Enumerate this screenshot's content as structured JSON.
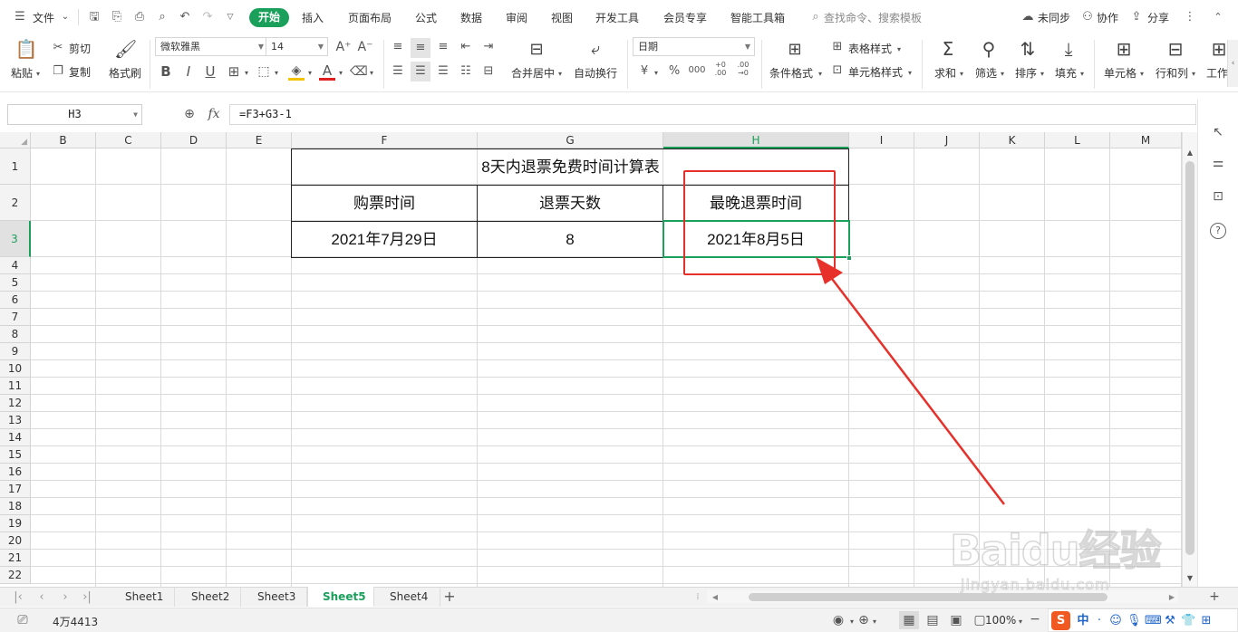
{
  "menubar": {
    "file_menu": "文件",
    "tabs": [
      "开始",
      "插入",
      "页面布局",
      "公式",
      "数据",
      "审阅",
      "视图",
      "开发工具",
      "会员专享",
      "智能工具箱"
    ],
    "search_placeholder": "查找命令、搜索模板",
    "sync": "未同步",
    "collab": "协作",
    "share": "分享"
  },
  "ribbon": {
    "paste": "粘贴",
    "cut": "剪切",
    "copy": "复制",
    "format_painter": "格式刷",
    "font_name": "微软雅黑",
    "font_size": "14",
    "merge_center": "合并居中",
    "wrap_text": "自动换行",
    "number_format": "日期",
    "conditional_format": "条件格式",
    "table_style": "表格样式",
    "cell_style": "单元格样式",
    "sum": "求和",
    "filter": "筛选",
    "sort": "排序",
    "fill": "填充",
    "cell": "单元格",
    "row_col": "行和列",
    "worksheet": "工作",
    "currency_symbol": "¥",
    "percent_symbol": "%",
    "thousands_symbol": "000",
    "dec_inc": "+0 .00",
    "dec_dec": ".00 →0"
  },
  "formula_bar": {
    "name_box": "H3",
    "fx_label": "fx",
    "formula": "=F3+G3-1"
  },
  "columns": [
    "B",
    "C",
    "D",
    "E",
    "F",
    "G",
    "H",
    "I",
    "J",
    "K",
    "L",
    "M"
  ],
  "rows": [
    "1",
    "2",
    "3",
    "4",
    "5",
    "6",
    "7",
    "8",
    "9",
    "10",
    "11",
    "12",
    "13",
    "14",
    "15",
    "16",
    "17",
    "18",
    "19",
    "20",
    "21",
    "22"
  ],
  "table": {
    "title": "8天内退票免费时间计算表",
    "headers": [
      "购票时间",
      "退票天数",
      "最晚退票时间"
    ],
    "values": [
      "2021年7月29日",
      "8",
      "2021年8月5日"
    ]
  },
  "sheets": [
    "Sheet1",
    "Sheet2",
    "Sheet3",
    "Sheet5",
    "Sheet4"
  ],
  "active_sheet": "Sheet5",
  "status_bar": {
    "count": "4万4413",
    "zoom": "100%"
  },
  "watermark": {
    "brand": "Baidu经验",
    "url": "jingyan.baidu.com"
  },
  "colors": {
    "accent": "#1aa05a",
    "annotation": "#e8302a"
  }
}
